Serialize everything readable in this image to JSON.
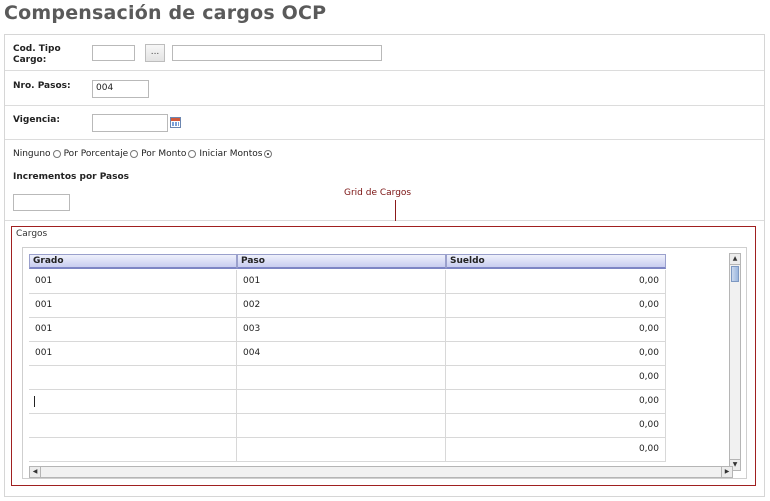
{
  "page": {
    "title": "Compensación de cargos OCP"
  },
  "form": {
    "cod_tipo_cargo": {
      "label": "Cod. Tipo Cargo:",
      "code_value": "",
      "desc_value": "",
      "lookup_label": "..."
    },
    "nro_pasos": {
      "label": "Nro. Pasos:",
      "value": "004"
    },
    "vigencia": {
      "label": "Vigencia:",
      "value": ""
    },
    "radios": [
      {
        "label": "Ninguno",
        "checked": false
      },
      {
        "label": "Por Porcentaje",
        "checked": false
      },
      {
        "label": "Por Monto",
        "checked": false
      },
      {
        "label": "Iniciar Montos",
        "checked": true
      }
    ],
    "incrementos": {
      "label": "Incrementos por Pasos",
      "value": ""
    }
  },
  "annotation": {
    "text": "Grid de Cargos"
  },
  "cargos": {
    "legend": "Cargos",
    "columns": [
      "Grado",
      "Paso",
      "Sueldo"
    ],
    "rows": [
      [
        "001",
        "001",
        "0,00"
      ],
      [
        "001",
        "002",
        "0,00"
      ],
      [
        "001",
        "003",
        "0,00"
      ],
      [
        "001",
        "004",
        "0,00"
      ],
      [
        "",
        "",
        "0,00"
      ],
      [
        "",
        "",
        "0,00"
      ],
      [
        "",
        "",
        "0,00"
      ],
      [
        "",
        "",
        "0,00"
      ]
    ]
  },
  "scrollbar": {
    "up_arrow": "▲",
    "down_arrow": "▼",
    "left_arrow": "◀",
    "right_arrow": "▶"
  }
}
